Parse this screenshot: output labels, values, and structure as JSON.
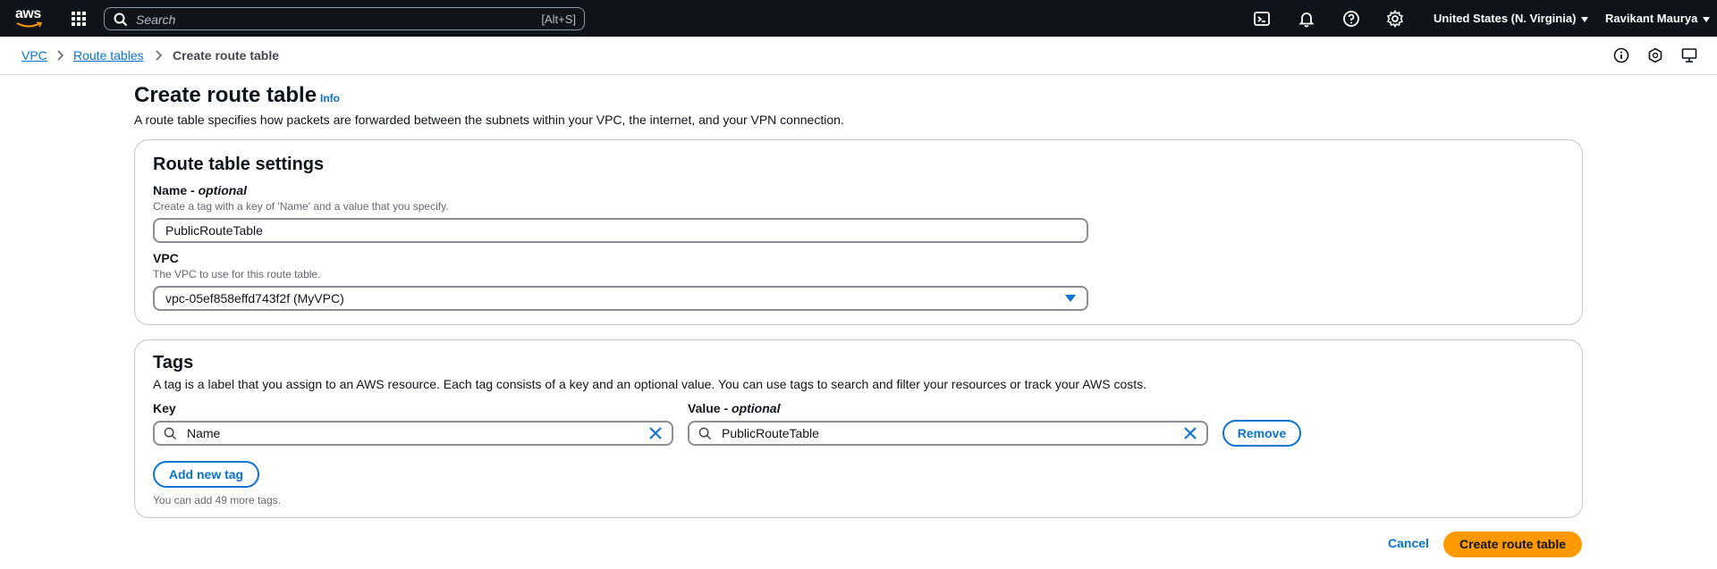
{
  "topnav": {
    "logo_text": "aws",
    "search_placeholder": "Search",
    "search_shortcut": "[Alt+S]",
    "region": "United States (N. Virginia)",
    "user": "Ravikant Maurya"
  },
  "breadcrumb": {
    "items": [
      "VPC",
      "Route tables",
      "Create route table"
    ]
  },
  "page": {
    "title": "Create route table",
    "info_link": "Info",
    "description": "A route table specifies how packets are forwarded between the subnets within your VPC, the internet, and your VPN connection."
  },
  "settings": {
    "heading": "Route table settings",
    "name_label": "Name - ",
    "name_optional": "optional",
    "name_hint": "Create a tag with a key of 'Name' and a value that you specify.",
    "name_value": "PublicRouteTable",
    "vpc_label": "VPC",
    "vpc_hint": "The VPC to use for this route table.",
    "vpc_value": "vpc-05ef858effd743f2f (MyVPC)"
  },
  "tags": {
    "heading": "Tags",
    "description": "A tag is a label that you assign to an AWS resource. Each tag consists of a key and an optional value. You can use tags to search and filter your resources or track your AWS costs.",
    "key_label": "Key",
    "value_label": "Value - ",
    "value_optional": "optional",
    "key_value": "Name",
    "value_value": "PublicRouteTable",
    "remove_label": "Remove",
    "add_label": "Add new tag",
    "limit_text": "You can add 49 more tags."
  },
  "footer": {
    "cancel_label": "Cancel",
    "create_label": "Create route table"
  },
  "colors": {
    "nav_bg": "#0f141a",
    "link": "#0972d3",
    "primary": "#ff9900"
  }
}
